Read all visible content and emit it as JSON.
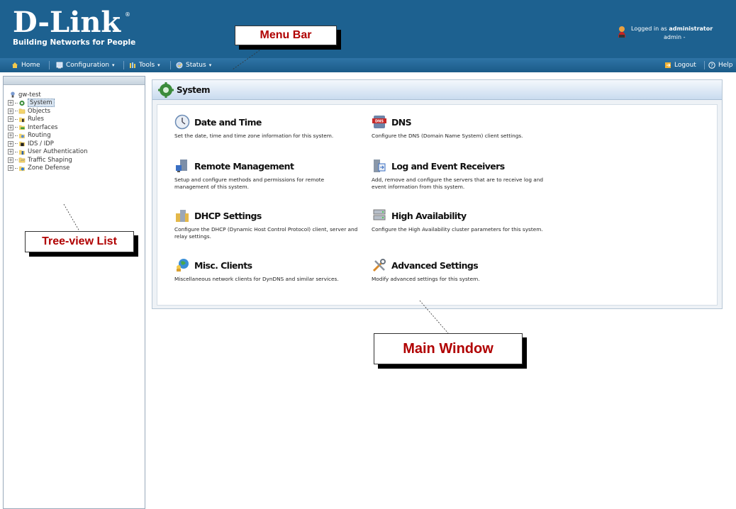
{
  "header": {
    "logo_text": "D-Link",
    "logo_registered": "®",
    "tagline": "Building Networks for People",
    "login_prefix": "Logged in as ",
    "login_user": "administrator",
    "login_sub": "admin -"
  },
  "menubar": {
    "home": "Home",
    "configuration": "Configuration",
    "tools": "Tools",
    "status": "Status",
    "logout": "Logout",
    "help": "Help",
    "caret": "▾"
  },
  "tree": {
    "root": "gw-test",
    "items": [
      {
        "label": "System"
      },
      {
        "label": "Objects"
      },
      {
        "label": "Rules"
      },
      {
        "label": "Interfaces"
      },
      {
        "label": "Routing"
      },
      {
        "label": "IDS / IDP"
      },
      {
        "label": "User Authentication"
      },
      {
        "label": "Traffic Shaping"
      },
      {
        "label": "Zone Defense"
      }
    ],
    "expander": "+"
  },
  "main": {
    "title": "System",
    "items": [
      {
        "title": "Date and Time",
        "desc": "Set the date, time and time zone information for this system."
      },
      {
        "title": "DNS",
        "desc": "Configure the DNS (Domain Name System) client settings."
      },
      {
        "title": "Remote Management",
        "desc": "Setup and configure methods and permissions for remote management of this system."
      },
      {
        "title": "Log and Event Receivers",
        "desc": "Add, remove and configure the servers that are to receive log and event information from this system."
      },
      {
        "title": "DHCP Settings",
        "desc": "Configure the DHCP (Dynamic Host Control Protocol) client, server and relay settings."
      },
      {
        "title": "High Availability",
        "desc": "Configure the High Availability cluster parameters for this system."
      },
      {
        "title": "Misc. Clients",
        "desc": "Miscellaneous network clients for DynDNS and similar services."
      },
      {
        "title": "Advanced Settings",
        "desc": "Modify advanced settings for this system."
      }
    ]
  },
  "callouts": {
    "menu_bar": "Menu Bar",
    "tree_view": "Tree-view List",
    "main_window": "Main Window"
  },
  "colors": {
    "header_bg": "#1d6190",
    "callout_text": "#b00000",
    "panel_title_bg": "#c9dbef"
  }
}
